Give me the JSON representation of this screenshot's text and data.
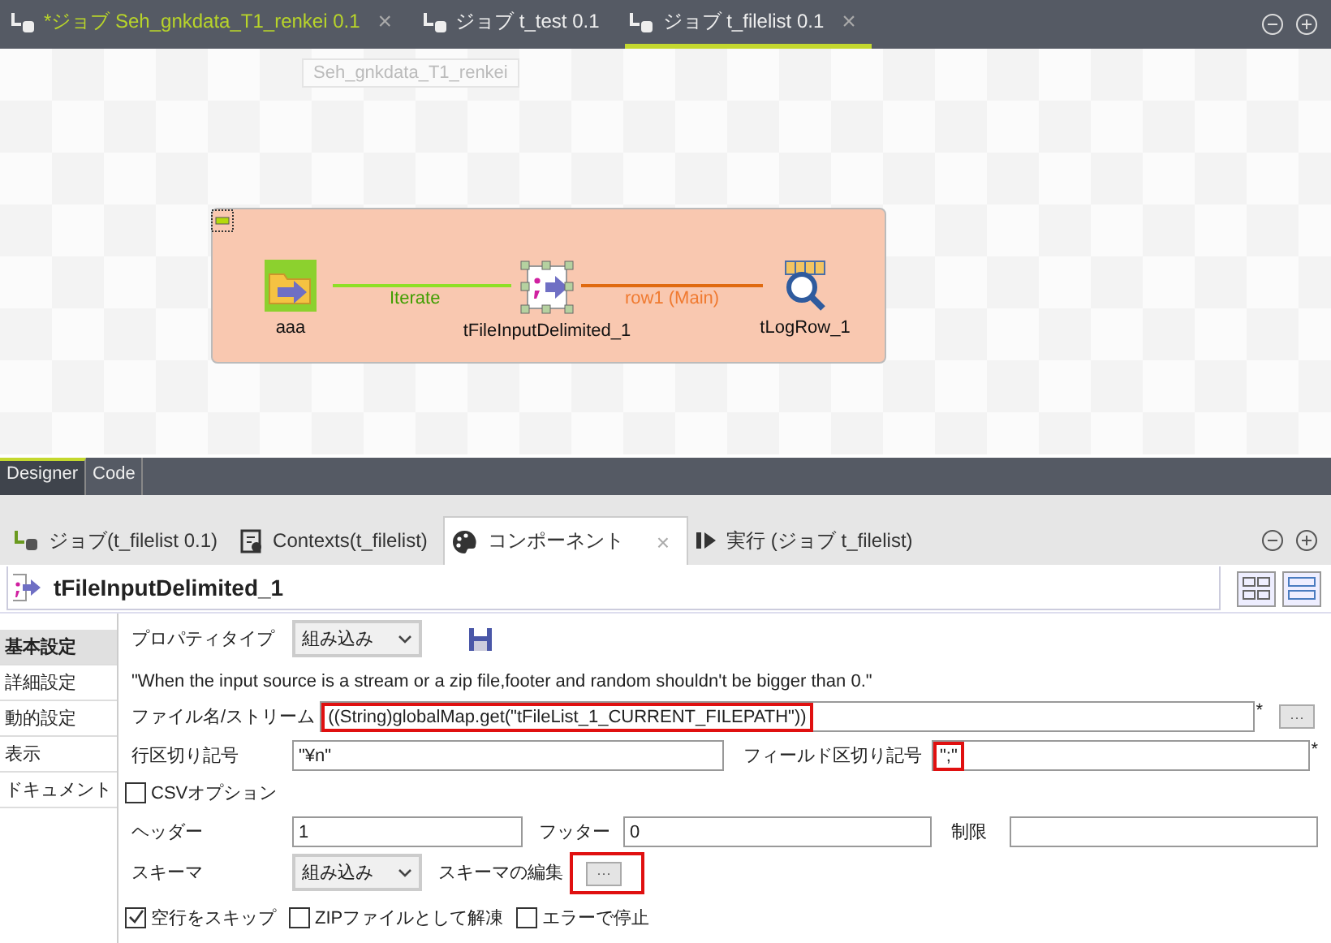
{
  "editor_tabs": [
    {
      "label": "*ジョブ Seh_gnkdata_T1_renkei 0.1",
      "modified": true,
      "close": "×",
      "selected": false
    },
    {
      "label": "ジョブ t_test 0.1",
      "modified": false,
      "selected": false
    },
    {
      "label": "ジョブ t_filelist 0.1",
      "modified": false,
      "close": "×",
      "selected": true
    }
  ],
  "tooltip": "Seh_gnkdata_T1_renkei",
  "designer": {
    "nodes": [
      {
        "label": "aaa",
        "kind": "filelist"
      },
      {
        "label": "tFileInputDelimited_1",
        "kind": "delimited"
      },
      {
        "label": "tLogRow_1",
        "kind": "logrow"
      }
    ],
    "links": [
      {
        "label": "Iterate",
        "kind": "iterate"
      },
      {
        "label": "row1 (Main)",
        "kind": "main"
      }
    ]
  },
  "view_tabs": [
    {
      "label": "Designer",
      "selected": true
    },
    {
      "label": "Code",
      "selected": false
    }
  ],
  "panel_tabs": [
    {
      "label": "ジョブ(t_filelist 0.1)",
      "kind": "job",
      "selected": false
    },
    {
      "label": "Contexts(t_filelist)",
      "kind": "contexts",
      "selected": false
    },
    {
      "label": "コンポーネント",
      "kind": "component",
      "selected": true,
      "close": "×"
    },
    {
      "label": "実行 (ジョブ t_filelist)",
      "kind": "run",
      "selected": false
    }
  ],
  "component": {
    "title": "tFileInputDelimited_1",
    "sections": [
      {
        "label": "基本設定",
        "selected": true
      },
      {
        "label": "詳細設定",
        "selected": false
      },
      {
        "label": "動的設定",
        "selected": false
      },
      {
        "label": "表示",
        "selected": false
      },
      {
        "label": "ドキュメント",
        "selected": false
      }
    ],
    "property_type": {
      "label": "プロパティタイプ",
      "value": "組み込み"
    },
    "note": "\"When the input source is a stream or a zip file,footer and random shouldn't be bigger than 0.\"",
    "file": {
      "label": "ファイル名/ストリーム",
      "value": "((String)globalMap.get(\"tFileList_1_CURRENT_FILEPATH\"))",
      "highlighted": true,
      "required_mark": "*",
      "button": "···"
    },
    "row_separator": {
      "label": "行区切り記号",
      "value": "\"¥n\"",
      "highlighted": false
    },
    "field_separator": {
      "label": "フィールド区切り記号",
      "value": "\";\"",
      "highlighted": true,
      "required_mark": "*"
    },
    "csv_options": {
      "label": "CSVオプション",
      "checked": false
    },
    "header": {
      "label": "ヘッダー",
      "value": "1"
    },
    "footer": {
      "label": "フッター",
      "value": "0"
    },
    "limit": {
      "label": "制限"
    },
    "schema": {
      "label": "スキーマ",
      "value": "組み込み",
      "edit_label": "スキーマの編集",
      "edit_button": "···",
      "edit_highlighted": true
    },
    "options": [
      {
        "label": "空行をスキップ",
        "checked": true
      },
      {
        "label": "ZIPファイルとして解凍",
        "checked": false
      },
      {
        "label": "エラーで停止",
        "checked": false
      }
    ]
  }
}
